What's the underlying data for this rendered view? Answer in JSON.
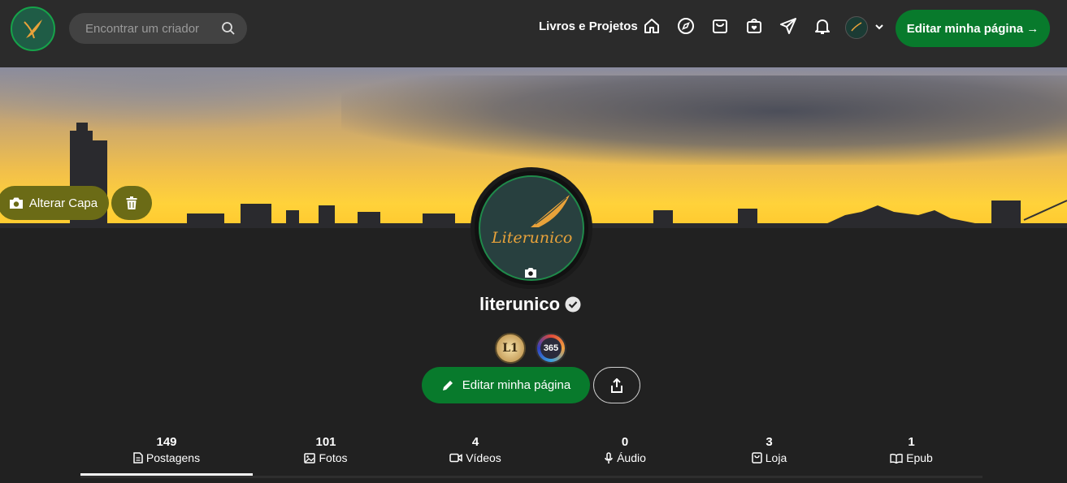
{
  "header": {
    "search_placeholder": "Encontrar um criador",
    "nav_link": "Livros e Projetos",
    "edit_button": "Editar minha página →",
    "icons": [
      "home-icon",
      "compass-icon",
      "shopping-bag-icon",
      "bag-heart-icon",
      "send-icon",
      "bell-icon"
    ]
  },
  "cover": {
    "change_cover_label": "Alterar Capa"
  },
  "profile": {
    "username": "literunico",
    "logo_script": "Literunico",
    "edit_button": "Editar minha página",
    "badges": [
      "L1",
      "365"
    ]
  },
  "tabs": [
    {
      "count": "149",
      "label": "Postagens",
      "icon": "document-icon",
      "active": true
    },
    {
      "count": "101",
      "label": "Fotos",
      "icon": "image-icon",
      "active": false
    },
    {
      "count": "4",
      "label": "Vídeos",
      "icon": "video-icon",
      "active": false
    },
    {
      "count": "0",
      "label": "Áudio",
      "icon": "microphone-icon",
      "active": false
    },
    {
      "count": "3",
      "label": "Loja",
      "icon": "shop-bag-icon",
      "active": false
    },
    {
      "count": "1",
      "label": "Epub",
      "icon": "book-icon",
      "active": false
    }
  ],
  "colors": {
    "accent_green": "#087a2c",
    "topbar": "#2b2b2b",
    "background": "#212121",
    "cover_button": "#6b6b16"
  }
}
